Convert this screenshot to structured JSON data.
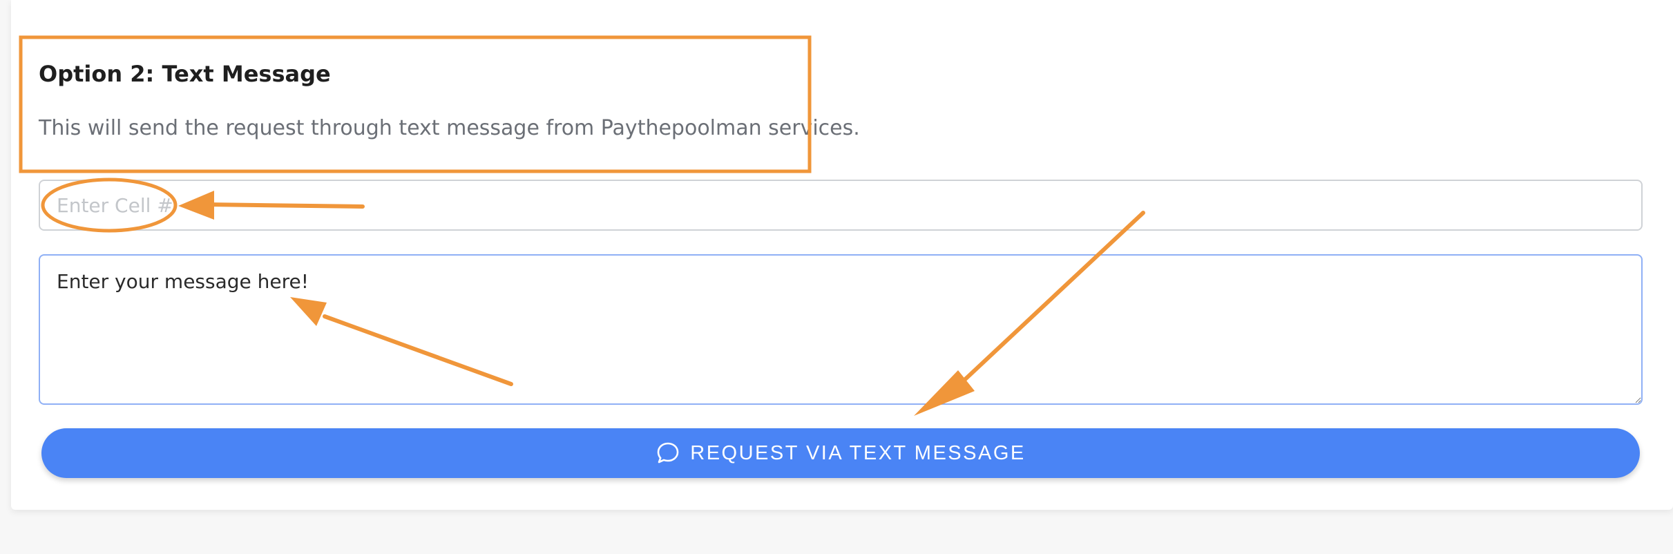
{
  "option": {
    "title": "Option 2: Text Message",
    "description": "This will send the request through text message from Paythepoolman services."
  },
  "cell_input": {
    "placeholder": "Enter Cell #",
    "value": ""
  },
  "message_input": {
    "value": "Enter your message here!"
  },
  "request_button": {
    "label": "REQUEST VIA TEXT MESSAGE",
    "icon": "chat-bubble-icon"
  },
  "colors": {
    "accent": "#4a84f5",
    "annotation": "#f0963a"
  }
}
